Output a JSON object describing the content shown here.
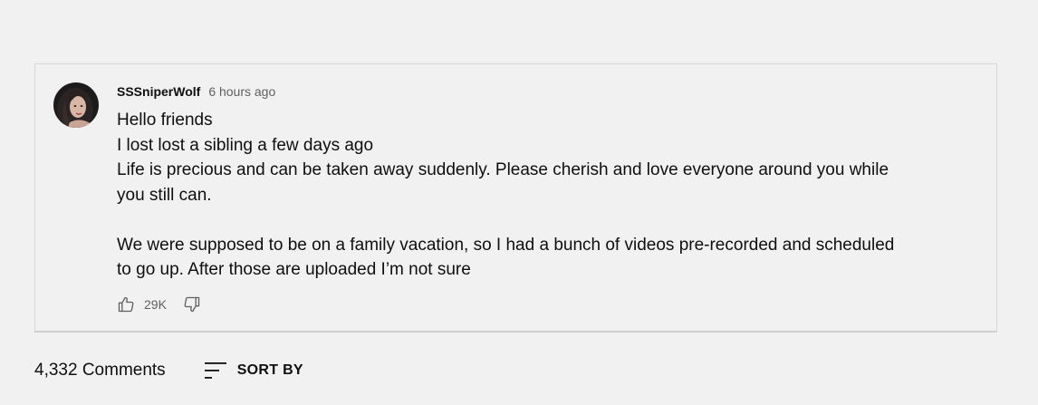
{
  "comment": {
    "author": "SSSniperWolf",
    "timestamp": "6 hours ago",
    "avatar": "avatar-photo",
    "lines": [
      "Hello friends",
      "I lost lost a sibling a few days ago",
      "Life is precious and can be taken away suddenly. Please cherish and love everyone around you while",
      "you still can.",
      "",
      "We were supposed to be on a family vacation, so I had a bunch of videos pre-recorded and scheduled",
      "to go up. After those are uploaded I’m not sure"
    ],
    "like_count": "29K",
    "like_icon": "thumbs-up-icon",
    "dislike_icon": "thumbs-down-icon"
  },
  "comments_section": {
    "count_label": "4,332 Comments",
    "sort_label": "SORT BY",
    "sort_icon": "sort-icon"
  },
  "colors": {
    "background": "#f1f1f1",
    "text_primary": "#0f0f0f",
    "text_secondary": "#606060",
    "border": "#d6d6d6"
  }
}
